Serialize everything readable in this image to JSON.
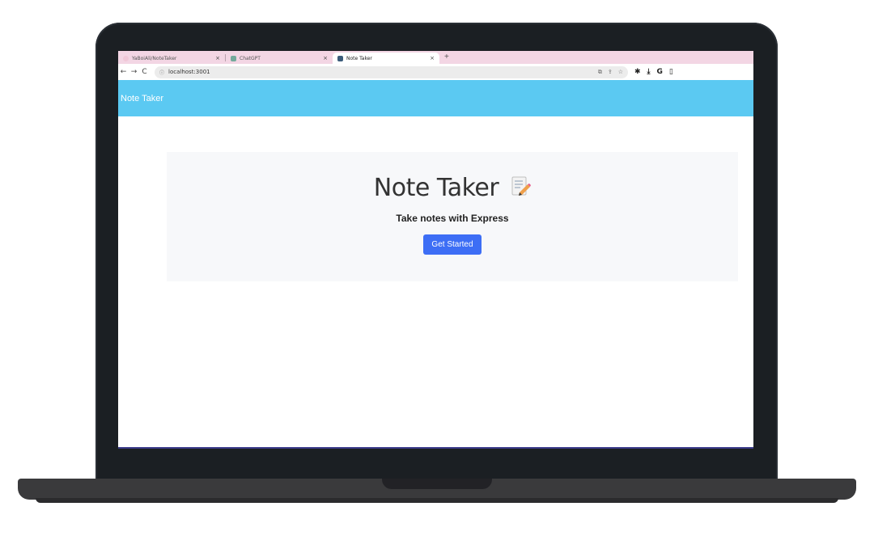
{
  "browser": {
    "tabs": [
      {
        "label": "YaBoiAli/NoteTaker",
        "close": "×"
      },
      {
        "label": "ChatGPT",
        "close": "×"
      },
      {
        "label": "Note Taker",
        "close": "×"
      }
    ],
    "new_tab": "+",
    "address": "localhost:3001",
    "nav": {
      "back": "←",
      "forward": "→",
      "reload": "C"
    }
  },
  "navbar": {
    "brand": "Note Taker"
  },
  "hero": {
    "title": "Note Taker",
    "subtitle": "Take notes with Express",
    "button_label": "Get Started"
  },
  "colors": {
    "navbar": "#5bc9f2",
    "button": "#3d6ef5",
    "hero_bg": "#f7f8fa",
    "tabbar": "#f3d6e4"
  }
}
